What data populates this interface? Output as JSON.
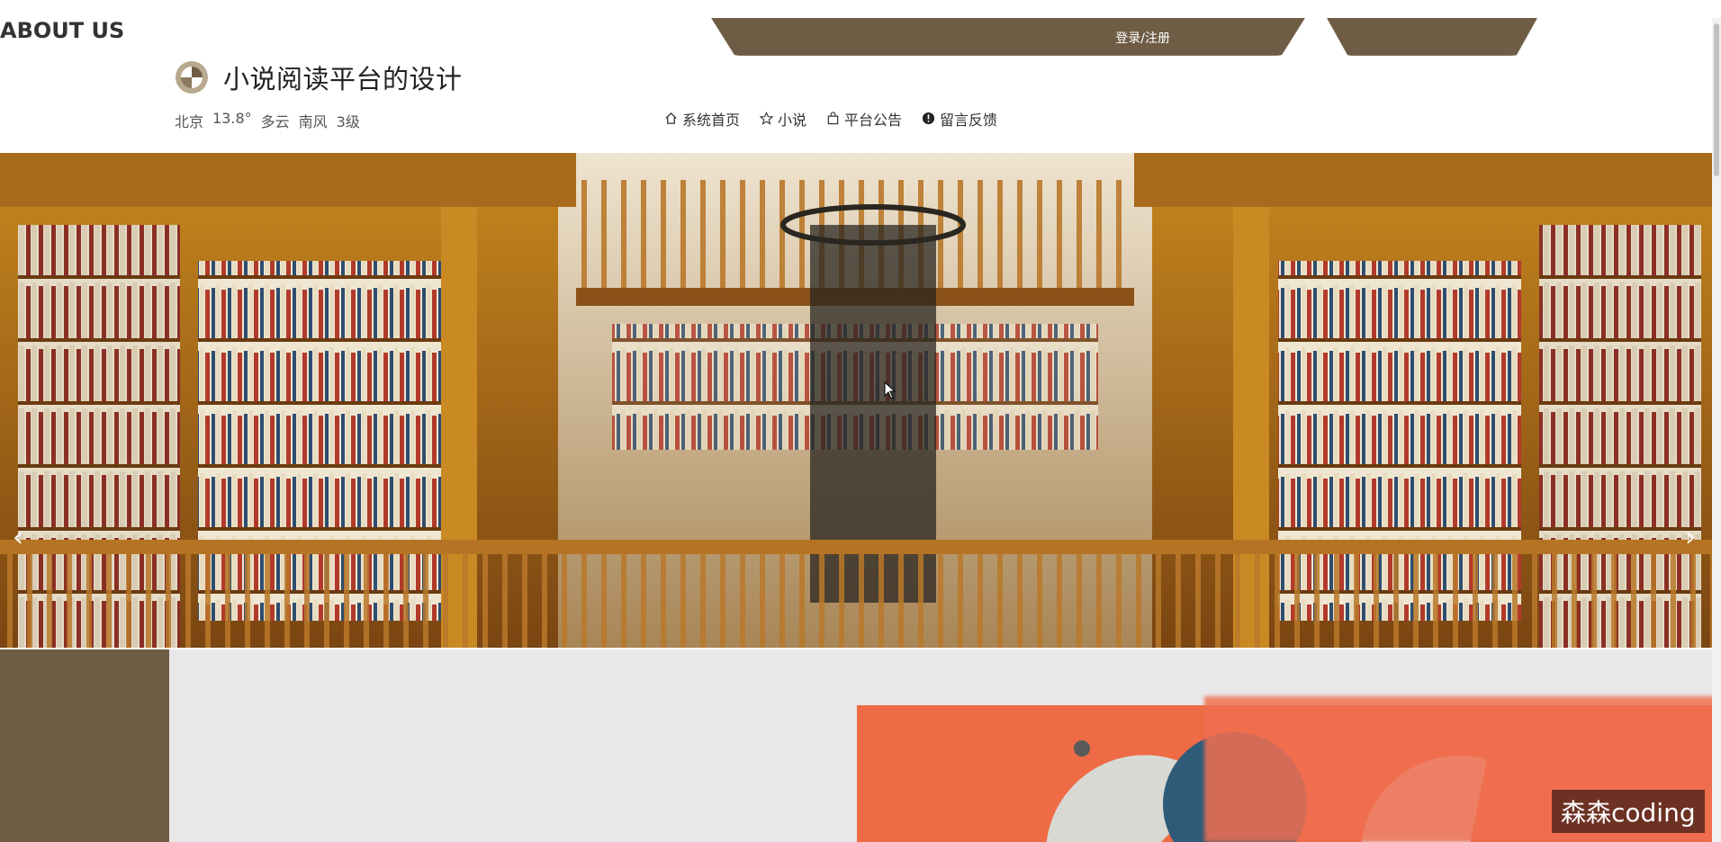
{
  "header": {
    "login_label": "登录/注册",
    "site_title": "小说阅读平台的设计",
    "weather": {
      "city": "北京",
      "temperature": "13.8°",
      "condition": "多云",
      "wind": "南风",
      "level": "3级"
    },
    "nav": [
      {
        "label": "系统首页",
        "icon": "home-icon"
      },
      {
        "label": "小说",
        "icon": "star-icon"
      },
      {
        "label": "平台公告",
        "icon": "bag-icon"
      },
      {
        "label": "留言反馈",
        "icon": "info-icon"
      }
    ]
  },
  "banner": {
    "slide_count": 5,
    "active_slide": 1
  },
  "about": {
    "heading": "ABOUT US"
  },
  "watermark": "森森coding",
  "colors": {
    "brand_brown": "#6e5c45",
    "about_orange": "#ee6b45"
  }
}
